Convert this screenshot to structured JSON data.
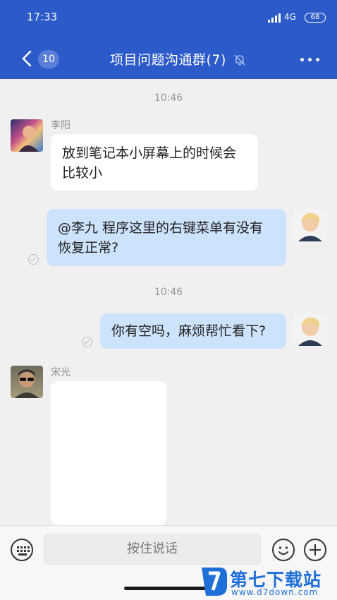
{
  "status_bar": {
    "time": "17:33",
    "network": "4G",
    "battery": "68"
  },
  "header": {
    "back_count": "10",
    "title": "项目问题沟通群(7)",
    "mute_icon": "bell-off-icon",
    "more_icon": "more-dots-icon"
  },
  "messages": [
    {
      "type": "time",
      "text": "10:46"
    },
    {
      "type": "incoming",
      "sender": "李阳",
      "text_lines": [
        "放到笔记本小屏幕上的时候会",
        "比较小"
      ]
    },
    {
      "type": "outgoing",
      "text_lines": [
        "@李九 程序这里的右键菜单有没有",
        "恢复正常?"
      ],
      "read": true
    },
    {
      "type": "time",
      "text": "10:46"
    },
    {
      "type": "outgoing",
      "text_lines": [
        "你有空吗，麻烦帮忙看下?"
      ],
      "read": true
    },
    {
      "type": "incoming",
      "sender": "宋光",
      "kind": "image"
    }
  ],
  "input_bar": {
    "voice_label": "按住说话",
    "keyboard_icon": "keyboard-icon",
    "emoji_icon": "emoji-icon",
    "plus_icon": "plus-icon"
  },
  "watermark": {
    "title": "第七下载站",
    "url": "www.d7down.com"
  },
  "colors": {
    "header_bg": "#2d5ac9",
    "outgoing_bubble": "#cde2fb",
    "incoming_bubble": "#ffffff",
    "chat_bg": "#f0f0f0"
  }
}
